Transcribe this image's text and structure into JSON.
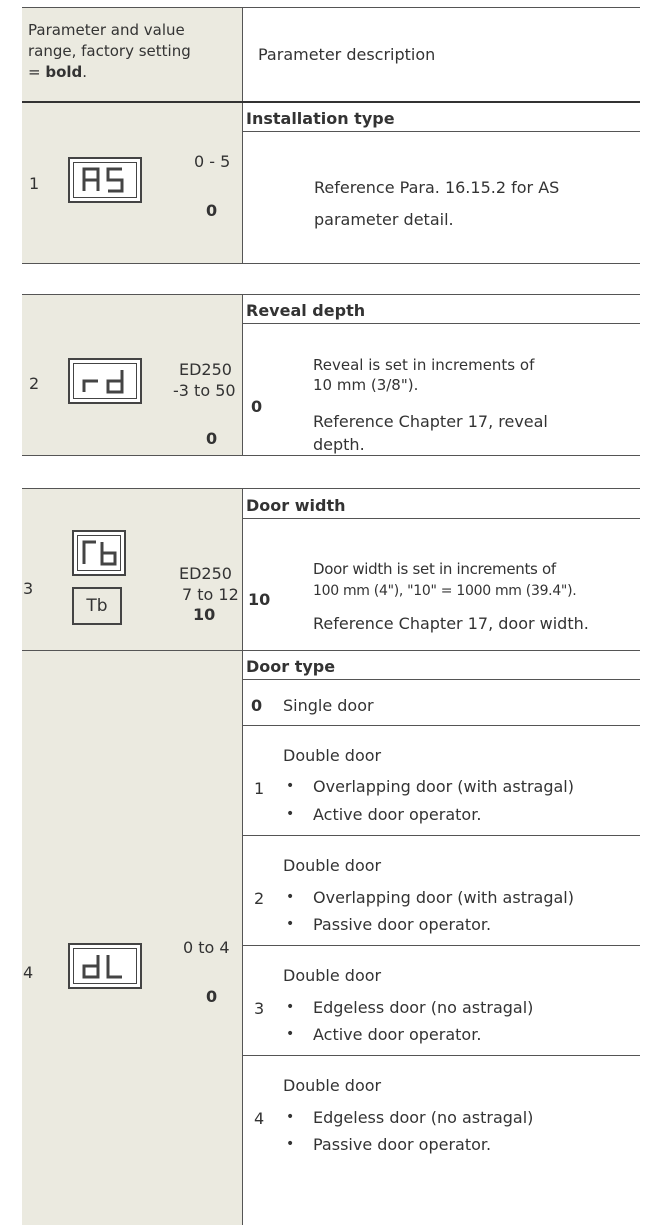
{
  "header": {
    "left_line1": "Parameter and value",
    "left_line2": "range, factory setting",
    "left_prefix": "= ",
    "left_bold": "bold",
    "left_suffix": ".",
    "right": "Parameter description"
  },
  "rows": [
    {
      "number": "1",
      "display_code": "AS",
      "range": "0 - 5",
      "default": "0",
      "title": "Installation type",
      "desc_line1": "Reference Para. 16.15.2 for AS",
      "desc_line2": "parameter detail."
    },
    {
      "number": "2",
      "display_code": "rd",
      "range_line1": "ED250",
      "range_line2": "-3 to 50",
      "default": "0",
      "title": "Reveal depth",
      "value": "0",
      "desc_line1": "Reveal is set in increments of",
      "desc_line2": "10 mm (3/8\").",
      "desc_line3": "Reference Chapter 17, reveal",
      "desc_line4": "depth."
    },
    {
      "number": "3",
      "display_code": "Γb",
      "display_text": "Tb",
      "range_line1": "ED250",
      "range_line2": "7 to 12",
      "default": "10",
      "title": "Door width",
      "value": "10",
      "desc_line1": "Door width is set in increments of",
      "desc_line2": "100 mm (4\"), \"10\" = 1000 mm (39.4\").",
      "desc_line3": "Reference Chapter 17, door width."
    },
    {
      "number": "4",
      "display_code": "dL",
      "range": "0 to 4",
      "default": "0",
      "title": "Door type",
      "options": [
        {
          "value": "0",
          "label": "Single door"
        },
        {
          "value": "1",
          "label": "Double door",
          "bullets": [
            "Overlapping door (with astragal)",
            "Active door operator."
          ]
        },
        {
          "value": "2",
          "label": "Double door",
          "bullets": [
            "Overlapping door (with astragal)",
            "Passive door operator."
          ]
        },
        {
          "value": "3",
          "label": "Double door",
          "bullets": [
            "Edgeless door (no astragal)",
            "Active door operator."
          ]
        },
        {
          "value": "4",
          "label": "Double door",
          "bullets": [
            "Edgeless door (no astragal)",
            "Passive door operator."
          ]
        }
      ]
    }
  ]
}
